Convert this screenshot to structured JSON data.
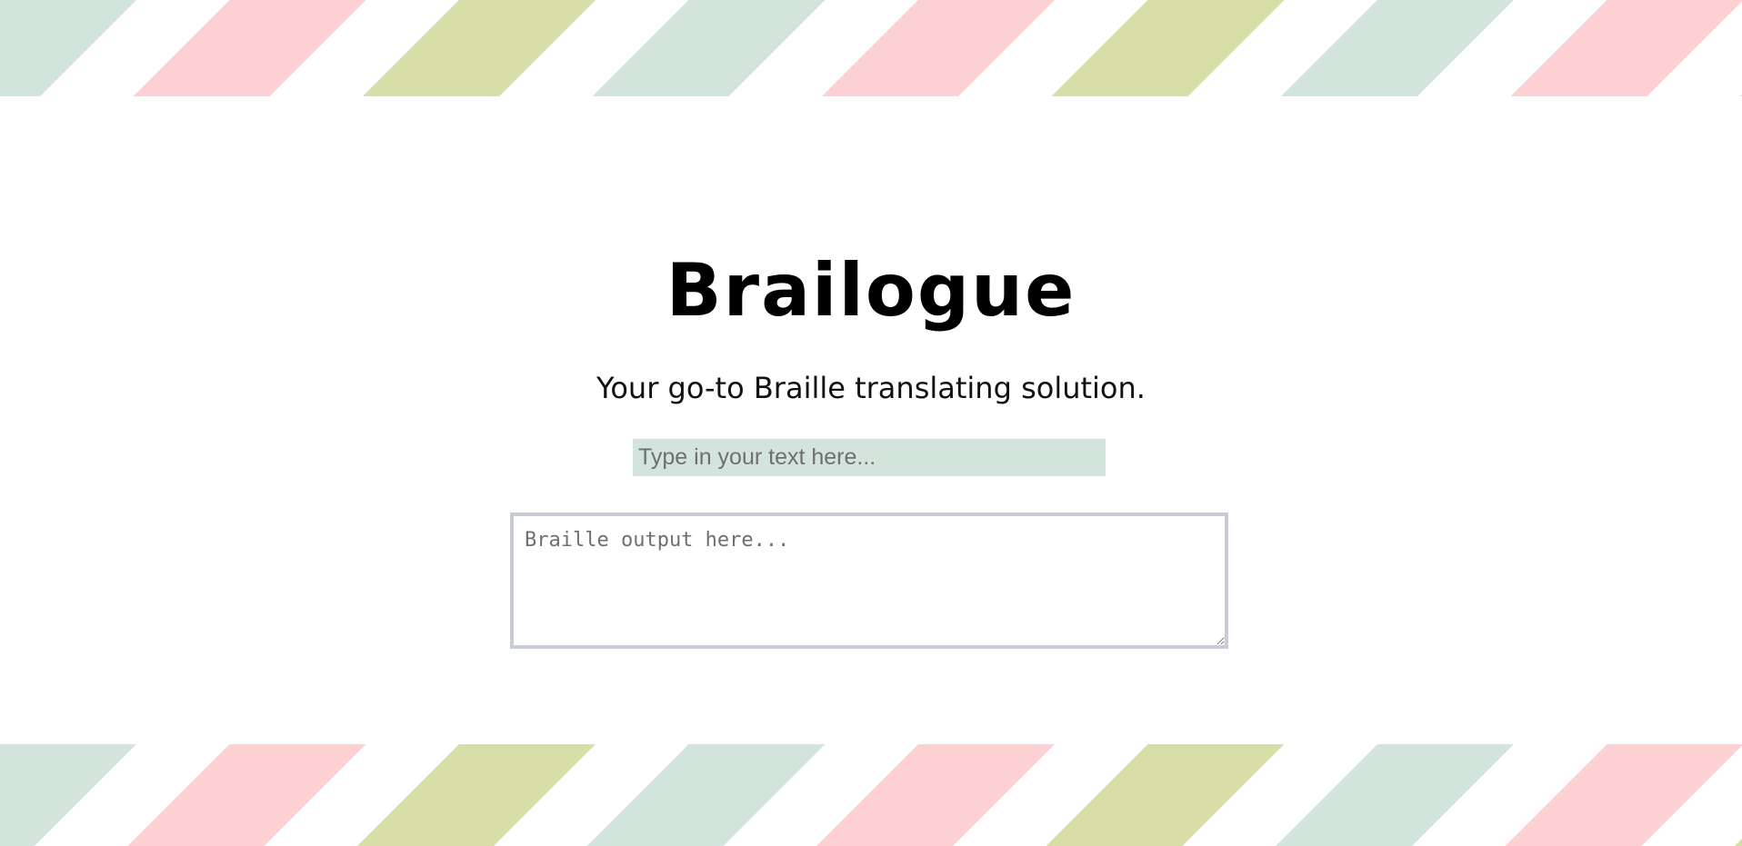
{
  "header": {
    "title": "Brailogue",
    "subtitle": "Your go-to Braille translating solution."
  },
  "translator": {
    "input_placeholder": "Type in your text here...",
    "input_value": "",
    "output_placeholder": "Braille output here...",
    "output_value": ""
  },
  "theme": {
    "stripe_colors": [
      "#d3e4dd",
      "#fdd0d3",
      "#d8dea8"
    ],
    "input_background": "#d3e4dd",
    "output_border": "#c7ccd6"
  }
}
